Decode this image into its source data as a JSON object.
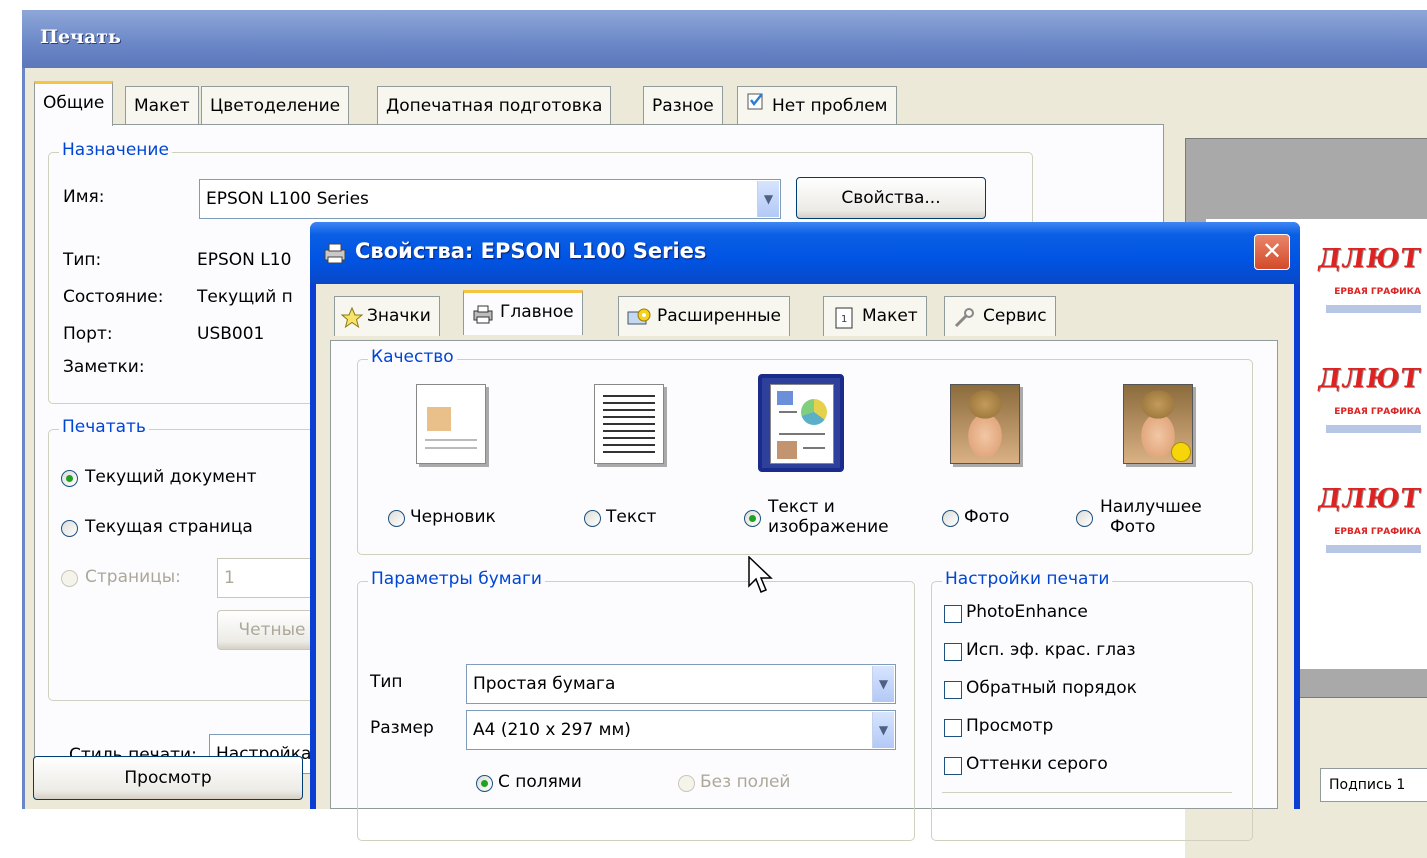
{
  "print_dialog": {
    "title": "Печать",
    "tabs": [
      {
        "label": "Общие",
        "active": true
      },
      {
        "label": "Макет"
      },
      {
        "label": "Цветоделение"
      },
      {
        "label": "Допечатная подготовка"
      },
      {
        "label": "Разное"
      },
      {
        "label": "Нет проблем",
        "icon": "checklist-icon"
      }
    ],
    "destination": {
      "group_title": "Назначение",
      "name_label": "Имя:",
      "name_value": "EPSON L100 Series",
      "properties_button": "Свойства...",
      "type_label": "Тип:",
      "type_value": "EPSON L10",
      "status_label": "Состояние:",
      "status_value": "Текущий п",
      "port_label": "Порт:",
      "port_value": "USB001",
      "notes_label": "Заметки:"
    },
    "print_range": {
      "group_title": "Печатать",
      "current_document": "Текущий документ",
      "current_page": "Текущая страница",
      "pages": "Страницы:",
      "pages_value": "1",
      "even_odd": "Четные"
    },
    "print_style_label": "Стиль печати:",
    "print_style_value": "Настройка",
    "preview_button": "Просмотр",
    "preview_panel": {
      "caption_tab": "Подпись 1",
      "logo_text": "ДЛЮТ",
      "logo_subtitle": "ЕРВАЯ ГРАФИКА"
    }
  },
  "properties_dialog": {
    "title": "Свойства: EPSON L100 Series",
    "close_label": "✕",
    "tabs": [
      {
        "label": "Значки",
        "icon": "star-icon"
      },
      {
        "label": "Главное",
        "icon": "printer-icon",
        "active": true
      },
      {
        "label": "Расширенные",
        "icon": "advanced-icon"
      },
      {
        "label": "Макет",
        "icon": "layout-icon"
      },
      {
        "label": "Сервис",
        "icon": "wrench-icon"
      }
    ],
    "quality": {
      "group_title": "Качество",
      "options": [
        {
          "label": "Черновик",
          "selected": false
        },
        {
          "label": "Текст",
          "selected": false
        },
        {
          "label_line1": "Текст и",
          "label_line2": "изображение",
          "selected": true
        },
        {
          "label": "Фото",
          "selected": false
        },
        {
          "label_line1": "Наилучшее",
          "label_line2": "Фото",
          "selected": false
        }
      ]
    },
    "paper": {
      "group_title": "Параметры бумаги",
      "type_label": "Тип",
      "type_value": "Простая бумага",
      "size_label": "Размер",
      "size_value": "A4 (210 x 297 мм)",
      "with_margins": "С полями",
      "borderless": "Без полей"
    },
    "print_settings": {
      "group_title": "Настройки печати",
      "options": [
        "PhotoEnhance",
        "Исп. эф. крас. глаз",
        "Обратный порядок",
        "Просмотр",
        "Оттенки серого"
      ]
    }
  }
}
